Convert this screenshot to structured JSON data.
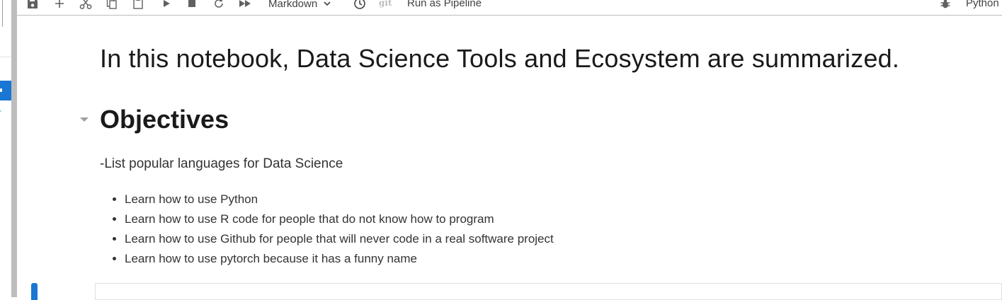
{
  "toolbar": {
    "cell_type": "Markdown",
    "git": "git",
    "run_pipeline": "Run as Pipeline",
    "kernel_name": "Python",
    "icons": [
      "save-icon",
      "add-icon",
      "cut-icon",
      "copy-icon",
      "paste-icon",
      "run-icon",
      "stop-icon",
      "restart-icon",
      "fast-forward-icon",
      "chevron-down-icon",
      "clock-icon",
      "bug-icon"
    ]
  },
  "notebook": {
    "title": "In this notebook, Data Science Tools and Ecosystem are summarized.",
    "section_heading": "Objectives",
    "intro": "-List popular languages for Data Science",
    "objectives": [
      "Learn how to use Python",
      "Learn how to use R code for people that do not know how to program",
      "Learn how to use Github for people that will never code in a real software project",
      "Learn how to use pytorch because it has a funny name"
    ]
  },
  "colors": {
    "accent": "#1976d2",
    "icon": "#616161",
    "border": "#bdbdbd"
  }
}
